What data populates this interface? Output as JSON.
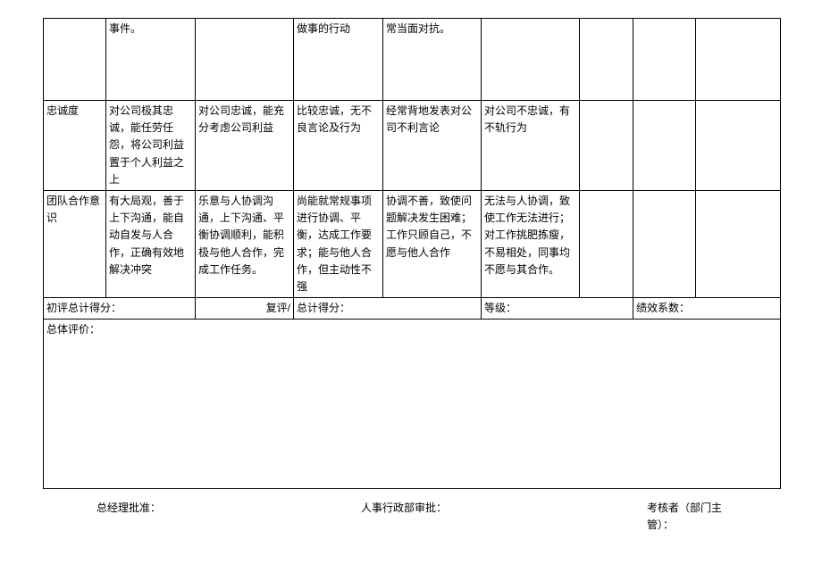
{
  "row0": {
    "c1": "事件。",
    "c3": "做事的行动",
    "c4": "常当面对抗。"
  },
  "row1": {
    "label": "忠诚度",
    "c1": "对公司极其忠诚，能任劳任怨，将公司利益置于个人利益之上",
    "c2": "对公司忠诚，能充分考虑公司利益",
    "c3": "比较忠诚，无不良言论及行为",
    "c4": "经常背地发表对公司不利言论",
    "c5": "对公司不忠诚，有不轨行为"
  },
  "row2": {
    "label": "团队合作意识",
    "c1": "有大局观，善于上下沟通，能自动自发与人合作，正确有效地解决冲突",
    "c2": "乐意与人协调沟通，上下沟通、平衡协调顺利，能积极与他人合作，完成工作任务。",
    "c3": "尚能就常规事项进行协调、平衡，达成工作要求；能与他人合作，但主动性不强",
    "c4": "协调不善，致使问题解决发生困难；工作只顾自己，不愿与他人合作",
    "c5": "无法与人协调，致使工作无法进行；对工作挑肥拣瘦，不易相处，同事均不愿与其合作。"
  },
  "scoreRow": {
    "l1": "初评总计得分：",
    "l2": "复评/",
    "l3": "总计得分：",
    "l4": "等级：",
    "l5": "绩效系数："
  },
  "evalRow": {
    "label": "总体评价："
  },
  "sigs": {
    "s1": "总经理批准：",
    "s2": "人事行政部审批：",
    "s3a": "考核者（部门主",
    "s3b": "管）："
  }
}
